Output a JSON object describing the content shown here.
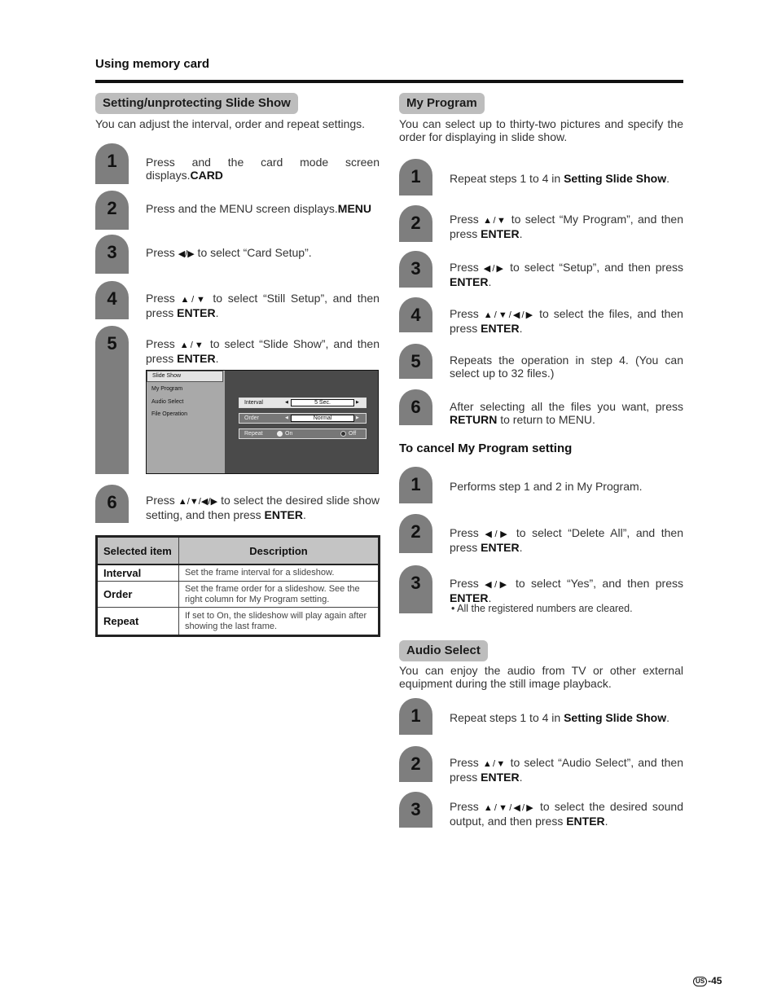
{
  "page": {
    "header": "Using memory card",
    "page_number": "-45",
    "region_badge": "US"
  },
  "left": {
    "section_title": "Setting/unprotecting Slide Show",
    "intro": "You can adjust the interval, order and repeat settings.",
    "steps": [
      {
        "num": "1",
        "pre": "Press ",
        "key": "CARD",
        "post": " and the card mode screen displays."
      },
      {
        "num": "2",
        "pre": "Press ",
        "key": "MENU",
        "post": " and the MENU screen displays."
      },
      {
        "num": "3",
        "pre": "Press ",
        "arrows": "◀/▶",
        "post": " to select “Card Setup”."
      },
      {
        "num": "4",
        "pre": "Press ",
        "arrows": "▲/▼",
        "post": " to select “Still Setup”, and then press ",
        "key": "ENTER",
        "end": "."
      },
      {
        "num": "5",
        "pre": "Press ",
        "arrows": "▲/▼",
        "post": " to select “Slide Show”, and then press ",
        "key": "ENTER",
        "end": "."
      },
      {
        "num": "6",
        "pre": "Press ",
        "arrows": "▲/▼/◀/▶",
        "post": " to select the desired slide show setting, and then press ",
        "key": "ENTER",
        "end": "."
      }
    ],
    "screen": {
      "menu": [
        "Slide Show",
        "My Program",
        "Audio Select",
        "File Operation"
      ],
      "selected_menu": "Slide Show",
      "options": [
        {
          "label": "Interval",
          "value": "5 Sec."
        },
        {
          "label": "Order",
          "value": "Normal"
        }
      ],
      "repeat": {
        "label": "Repeat",
        "on": "On",
        "off": "Off",
        "selected": "Off"
      }
    },
    "table": {
      "headers": [
        "Selected item",
        "Description"
      ],
      "rows": [
        {
          "item": "Interval",
          "desc": "Set the frame interval for a slideshow."
        },
        {
          "item": "Order",
          "desc": "Set the frame order for a slideshow. See the right column for My Program setting."
        },
        {
          "item": "Repeat",
          "desc": "If set to On, the slideshow will play again after showing the last frame."
        }
      ]
    }
  },
  "right": {
    "my_program": {
      "title": "My Program",
      "intro": "You can select up to thirty-two pictures and specify the order for displaying in slide show.",
      "steps": [
        {
          "num": "1",
          "pre": "Repeat steps 1 to 4 in ",
          "key": "Setting Slide Show",
          "end": "."
        },
        {
          "num": "2",
          "pre": "Press ",
          "arrows": "▲/▼",
          "post": " to select “My Program”, and then press ",
          "key": "ENTER",
          "end": "."
        },
        {
          "num": "3",
          "pre": "Press ",
          "arrows": "◀/▶",
          "post": " to select “Setup”, and then press ",
          "key": "ENTER",
          "end": "."
        },
        {
          "num": "4",
          "pre": "Press ",
          "arrows": "▲/▼/◀/▶",
          "post": " to select the files, and then press ",
          "key": "ENTER",
          "end": "."
        },
        {
          "num": "5",
          "pre": "Repeats the operation in step 4. (You can select up to 32 files.)"
        },
        {
          "num": "6",
          "pre": "After selecting all the files you want, press ",
          "key": "RETURN",
          "end": " to return to MENU."
        }
      ]
    },
    "cancel": {
      "title": "To cancel My Program setting",
      "steps": [
        {
          "num": "1",
          "pre": "Performs step 1 and 2 in My Program."
        },
        {
          "num": "2",
          "pre": "Press ",
          "arrows": "◀/▶",
          "post": " to select “Delete All”, and then press ",
          "key": "ENTER",
          "end": "."
        },
        {
          "num": "3",
          "pre": "Press ",
          "arrows": "◀/▶",
          "post": " to select “Yes”, and then press ",
          "key": "ENTER",
          "end": "."
        }
      ],
      "note": "All the registered numbers are cleared."
    },
    "audio_select": {
      "title": "Audio Select",
      "intro": "You can enjoy the audio from TV or other external equipment during the still image playback.",
      "steps": [
        {
          "num": "1",
          "pre": "Repeat steps 1 to 4 in ",
          "key": "Setting Slide Show",
          "end": "."
        },
        {
          "num": "2",
          "pre": "Press ",
          "arrows": "▲/▼",
          "post": " to select “Audio Select”, and then press ",
          "key": "ENTER",
          "end": "."
        },
        {
          "num": "3",
          "pre": "Press ",
          "arrows": "▲/▼/◀/▶",
          "post": " to select the desired sound output, and then press ",
          "key": "ENTER",
          "end": "."
        }
      ]
    }
  }
}
